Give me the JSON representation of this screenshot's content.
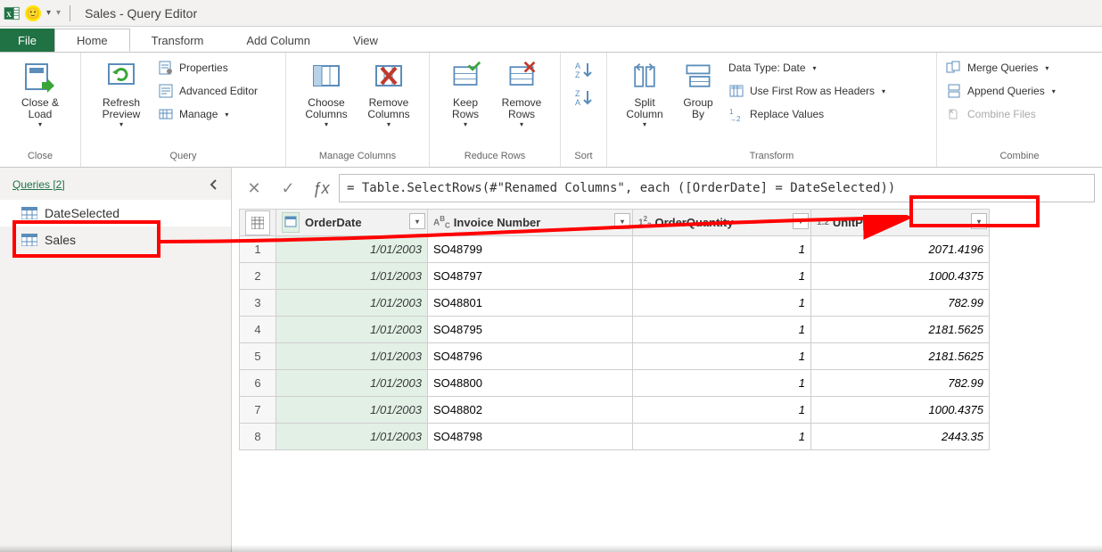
{
  "title_bar": {
    "app_title": "Sales - Query Editor"
  },
  "tabs": {
    "file": "File",
    "home": "Home",
    "transform": "Transform",
    "addcolumn": "Add Column",
    "view": "View"
  },
  "ribbon": {
    "close": {
      "close_load": "Close &\nLoad",
      "group": "Close"
    },
    "query": {
      "refresh": "Refresh\nPreview",
      "properties": "Properties",
      "advanced": "Advanced Editor",
      "manage": "Manage",
      "group": "Query"
    },
    "manage_cols": {
      "choose": "Choose\nColumns",
      "remove": "Remove\nColumns",
      "group": "Manage Columns"
    },
    "reduce_rows": {
      "keep": "Keep\nRows",
      "remove": "Remove\nRows",
      "group": "Reduce Rows"
    },
    "sort": {
      "group": "Sort"
    },
    "transform_group": {
      "split": "Split\nColumn",
      "groupby": "Group\nBy",
      "datatype": "Data Type: Date",
      "first_row": "Use First Row as Headers",
      "replace": "Replace Values",
      "group": "Transform"
    },
    "combine": {
      "merge": "Merge Queries",
      "append": "Append Queries",
      "combine_files": "Combine Files",
      "group": "Combine"
    }
  },
  "queries": {
    "header": "Queries [2]",
    "items": [
      {
        "label": "DateSelected"
      },
      {
        "label": "Sales"
      }
    ]
  },
  "formula": {
    "text": "= Table.SelectRows(#\"Renamed Columns\", each ([OrderDate] = DateSelected))"
  },
  "grid": {
    "headers": {
      "order_date": "OrderDate",
      "invoice": "Invoice Number",
      "qty": "OrderQuantity",
      "price": "UnitPrice"
    },
    "rows": [
      {
        "n": "1",
        "date": "1/01/2003",
        "inv": "SO48799",
        "qty": "1",
        "price": "2071.4196"
      },
      {
        "n": "2",
        "date": "1/01/2003",
        "inv": "SO48797",
        "qty": "1",
        "price": "1000.4375"
      },
      {
        "n": "3",
        "date": "1/01/2003",
        "inv": "SO48801",
        "qty": "1",
        "price": "782.99"
      },
      {
        "n": "4",
        "date": "1/01/2003",
        "inv": "SO48795",
        "qty": "1",
        "price": "2181.5625"
      },
      {
        "n": "5",
        "date": "1/01/2003",
        "inv": "SO48796",
        "qty": "1",
        "price": "2181.5625"
      },
      {
        "n": "6",
        "date": "1/01/2003",
        "inv": "SO48800",
        "qty": "1",
        "price": "782.99"
      },
      {
        "n": "7",
        "date": "1/01/2003",
        "inv": "SO48802",
        "qty": "1",
        "price": "1000.4375"
      },
      {
        "n": "8",
        "date": "1/01/2003",
        "inv": "SO48798",
        "qty": "1",
        "price": "2443.35"
      }
    ]
  }
}
